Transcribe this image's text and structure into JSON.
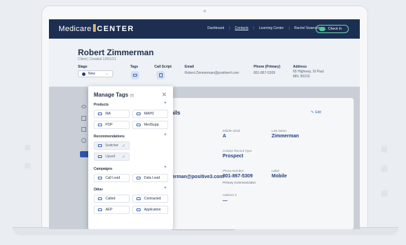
{
  "nav": {
    "logo_text": "Medicare",
    "logo_bold": "CENTER",
    "links": [
      "Dashboard",
      "Contacts",
      "Learning Center",
      "Rachel Swanson"
    ],
    "checkin_label": "Check In"
  },
  "client": {
    "name": "Robert Zimmerman",
    "sub": "Client | Created 10/01/21",
    "stage_label": "Stage",
    "stage_value": "New",
    "tags_label": "Tags",
    "callscript_label": "Call Script",
    "email_label": "Email",
    "email_value": "Robert.Zimmerman@positive4.com",
    "phone_label": "Phone (Primary)",
    "phone_value": "801-867-5309",
    "address_label": "Address",
    "address_line1": "65 Highway, St Paul",
    "address_line2": "MN, 90210"
  },
  "details": {
    "title": "etails",
    "edit": "Edit",
    "middle_initial_label": "Middle Initial",
    "middle_initial": "A",
    "last_name_label": "Last Name",
    "last_name": "Zimmerman",
    "contact_type_label": "Contact Record Type",
    "contact_type": "Prospect",
    "email_partial": "erman@positive3.com",
    "phone_label": "Phone Number",
    "phone": "801-867-5309",
    "phone_sub": "Primary Communication",
    "label_label": "Label",
    "label_value": "Mobile",
    "address2_label": "Address 2",
    "address2_value": "—"
  },
  "modal": {
    "title": "Manage Tags",
    "count": "(8)",
    "sections": {
      "products": "Products",
      "recommendations": "Recommendations",
      "campaigns": "Campaigns",
      "other": "Other"
    },
    "products": [
      "MA",
      "MAPD",
      "PDP",
      "MedSupp"
    ],
    "recommendations": [
      "Switcher",
      "Upsell"
    ],
    "campaigns": [
      "Call Lead",
      "Data Lead"
    ],
    "other": [
      "Called",
      "Contracted",
      "AEP",
      "Application"
    ]
  }
}
